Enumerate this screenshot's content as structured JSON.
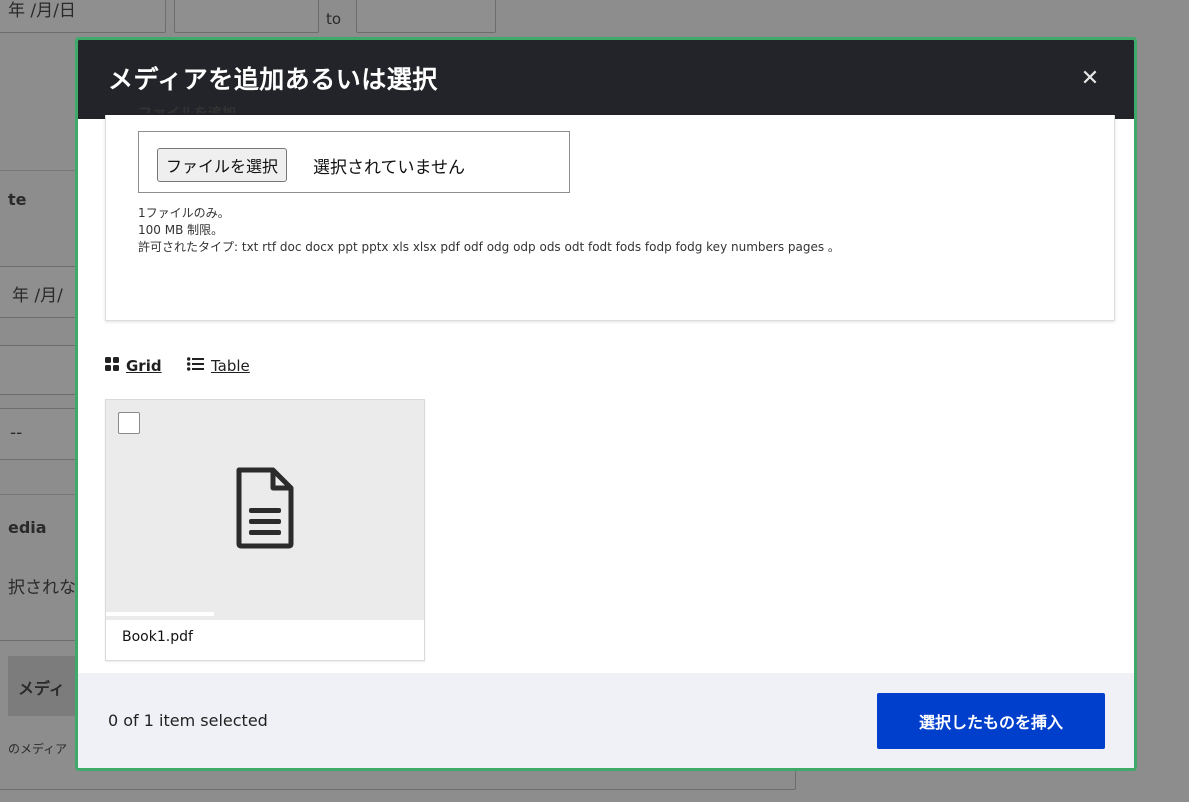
{
  "background": {
    "row1_date": "年 /月/日",
    "row1_to": "to",
    "label_date": "te",
    "row2_date": "年 /月/",
    "label_media": "edia",
    "media_status": "択されな",
    "media_button": "メディ",
    "media_desc": "のメディア"
  },
  "modal": {
    "title": "メディアを追加あるいは選択",
    "close_symbol": "✕",
    "upload": {
      "label": "ファイルを追加",
      "choose_button": "ファイルを選択",
      "status": "選択されていません",
      "help_count": "1ファイルのみ。",
      "help_size": "100 MB 制限。",
      "help_types": "許可されたタイプ: txt rtf doc docx ppt pptx xls xlsx pdf odf odg odp ods odt fodt fods fodp fodg key numbers pages 。"
    },
    "view": {
      "grid_label": "Grid",
      "table_label": "Table"
    },
    "media_items": [
      {
        "name": "Book1.pdf",
        "icon": "document-icon"
      }
    ],
    "footer": {
      "selected_count": "0 of 1 item selected",
      "insert_button": "選択したものを挿入"
    }
  },
  "colors": {
    "header_bg": "#232429",
    "modal_border": "#3fa96a",
    "insert_button_bg": "#003ecc",
    "footer_bg": "#eff1f6"
  }
}
